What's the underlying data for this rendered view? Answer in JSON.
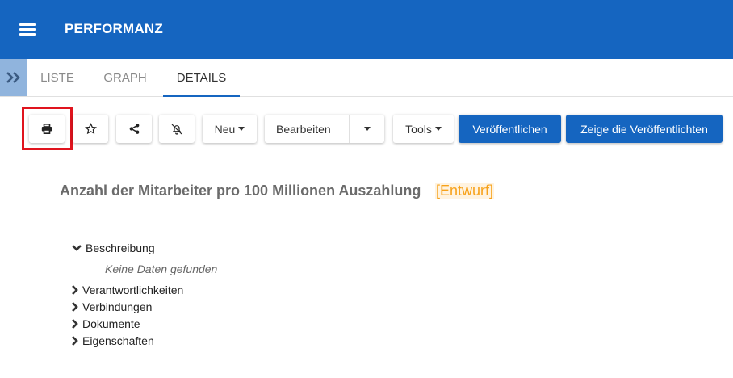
{
  "app": {
    "title": "PERFORMANZ"
  },
  "tabs": [
    {
      "label": "LISTE",
      "active": false
    },
    {
      "label": "GRAPH",
      "active": false
    },
    {
      "label": "DETAILS",
      "active": true
    }
  ],
  "toolbar": {
    "print_icon": "print-icon",
    "favorite_icon": "star-icon",
    "share_icon": "share-icon",
    "notify_icon": "bell-off-icon",
    "new_label": "Neu",
    "edit_label": "Bearbeiten",
    "tools_label": "Tools",
    "publish_label": "Veröffentlichen",
    "show_published_label": "Zeige die Veröffentlichten"
  },
  "document": {
    "title": "Anzahl der Mitarbeiter pro 100 Millionen Auszahlung",
    "status": "[Entwurf]"
  },
  "sections": [
    {
      "label": "Beschreibung",
      "expanded": true,
      "empty_text": "Keine Daten gefunden"
    },
    {
      "label": "Verantwortlichkeiten",
      "expanded": false
    },
    {
      "label": "Verbindungen",
      "expanded": false
    },
    {
      "label": "Dokumente",
      "expanded": false
    },
    {
      "label": "Eigenschaften",
      "expanded": false
    }
  ],
  "colors": {
    "brand": "#1565c0",
    "status_draft": "#f7a21b",
    "highlight": "#e0141e"
  }
}
